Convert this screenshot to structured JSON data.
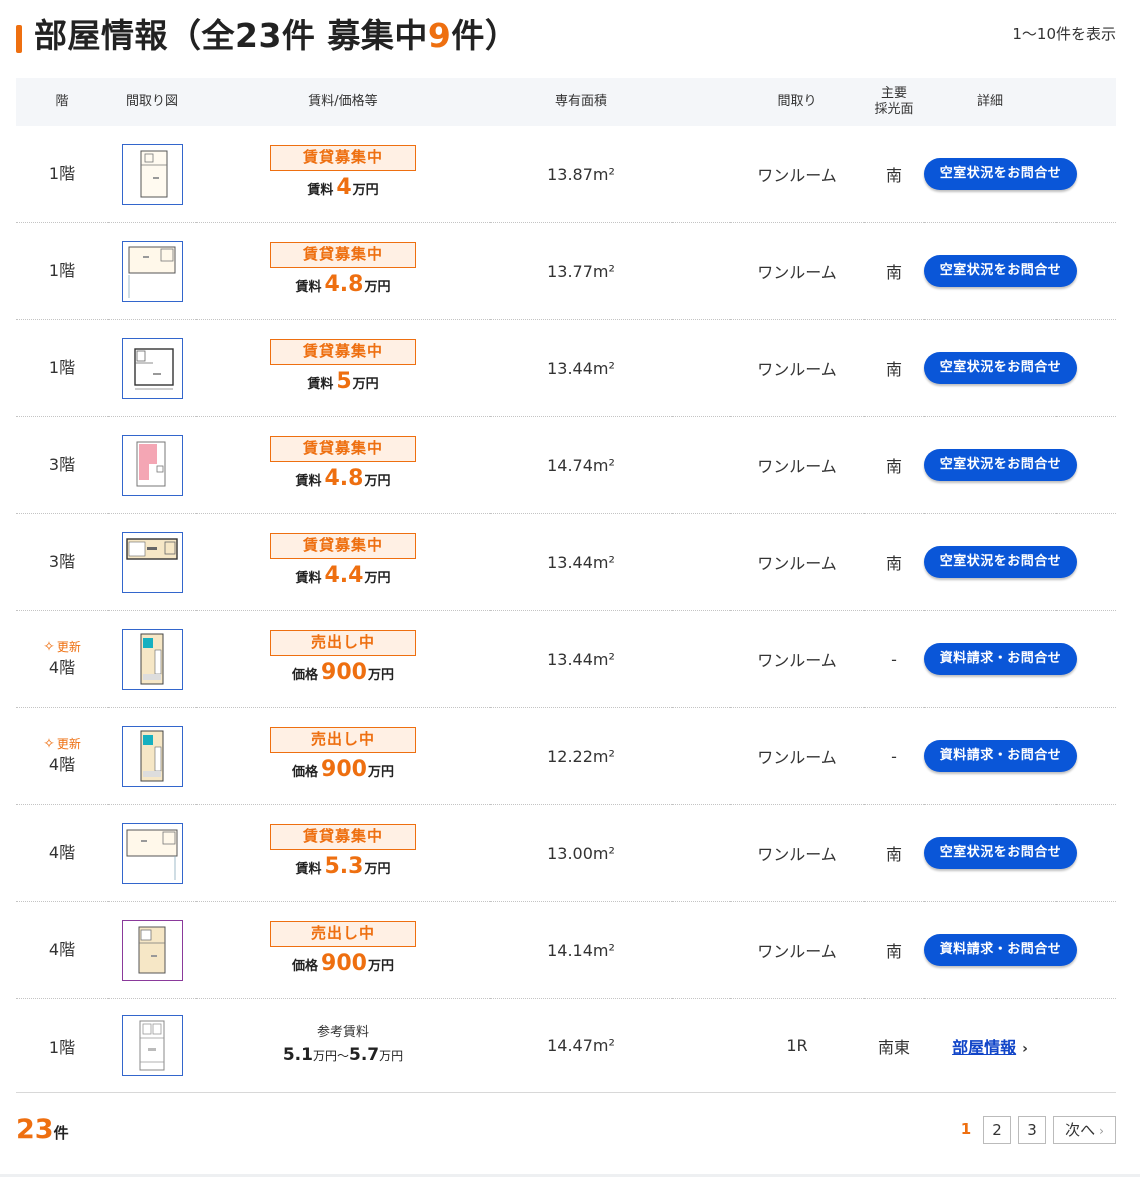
{
  "header": {
    "title_prefix": "部屋情報（全23件 募集中",
    "title_count": "9",
    "title_suffix": "件）",
    "range": "1〜10件を表示"
  },
  "columns": {
    "floor": "階",
    "plan": "間取り図",
    "price": "賃料/価格等",
    "area": "専有面積",
    "layout": "間取り",
    "light_line1": "主要",
    "light_line2": "採光面",
    "detail": "詳細"
  },
  "rows": [
    {
      "floor": "1階",
      "new_label": "",
      "status": "賃貸募集中",
      "price_label": "賃料",
      "price_value": "4",
      "price_unit": "万円",
      "area": "13.87m²",
      "layout": "ワンルーム",
      "light": "南",
      "action": "空室状況をお問合せ"
    },
    {
      "floor": "1階",
      "new_label": "",
      "status": "賃貸募集中",
      "price_label": "賃料",
      "price_value": "4.8",
      "price_unit": "万円",
      "area": "13.77m²",
      "layout": "ワンルーム",
      "light": "南",
      "action": "空室状況をお問合せ"
    },
    {
      "floor": "1階",
      "new_label": "",
      "status": "賃貸募集中",
      "price_label": "賃料",
      "price_value": "5",
      "price_unit": "万円",
      "area": "13.44m²",
      "layout": "ワンルーム",
      "light": "南",
      "action": "空室状況をお問合せ"
    },
    {
      "floor": "3階",
      "new_label": "",
      "status": "賃貸募集中",
      "price_label": "賃料",
      "price_value": "4.8",
      "price_unit": "万円",
      "area": "14.74m²",
      "layout": "ワンルーム",
      "light": "南",
      "action": "空室状況をお問合せ"
    },
    {
      "floor": "3階",
      "new_label": "",
      "status": "賃貸募集中",
      "price_label": "賃料",
      "price_value": "4.4",
      "price_unit": "万円",
      "area": "13.44m²",
      "layout": "ワンルーム",
      "light": "南",
      "action": "空室状況をお問合せ"
    },
    {
      "floor": "4階",
      "new_label": "更新",
      "status": "売出し中",
      "price_label": "価格",
      "price_value": "900",
      "price_unit": "万円",
      "area": "13.44m²",
      "layout": "ワンルーム",
      "light": "-",
      "action": "資料請求・お問合せ"
    },
    {
      "floor": "4階",
      "new_label": "更新",
      "status": "売出し中",
      "price_label": "価格",
      "price_value": "900",
      "price_unit": "万円",
      "area": "12.22m²",
      "layout": "ワンルーム",
      "light": "-",
      "action": "資料請求・お問合せ"
    },
    {
      "floor": "4階",
      "new_label": "",
      "status": "賃貸募集中",
      "price_label": "賃料",
      "price_value": "5.3",
      "price_unit": "万円",
      "area": "13.00m²",
      "layout": "ワンルーム",
      "light": "南",
      "action": "空室状況をお問合せ"
    },
    {
      "floor": "4階",
      "new_label": "",
      "status": "売出し中",
      "price_label": "価格",
      "price_value": "900",
      "price_unit": "万円",
      "area": "14.14m²",
      "layout": "ワンルーム",
      "light": "南",
      "action": "資料請求・お問合せ"
    }
  ],
  "reference_row": {
    "floor": "1階",
    "ref_label": "参考賃料",
    "min": "5.1",
    "max": "5.7",
    "unit": "万円",
    "separator": "〜",
    "area": "14.47m²",
    "layout": "1R",
    "light": "南東",
    "link_label": "部屋情報"
  },
  "footer": {
    "count": "23",
    "count_unit": "件",
    "pages": [
      "1",
      "2",
      "3"
    ],
    "current_page": "1",
    "next_label": "次へ"
  },
  "colors": {
    "accent": "#ee6f10",
    "button": "#0a56d8",
    "link": "#1145c8"
  },
  "icons": {
    "new": "sparkle-icon",
    "chevron": "chevron-right-icon"
  }
}
